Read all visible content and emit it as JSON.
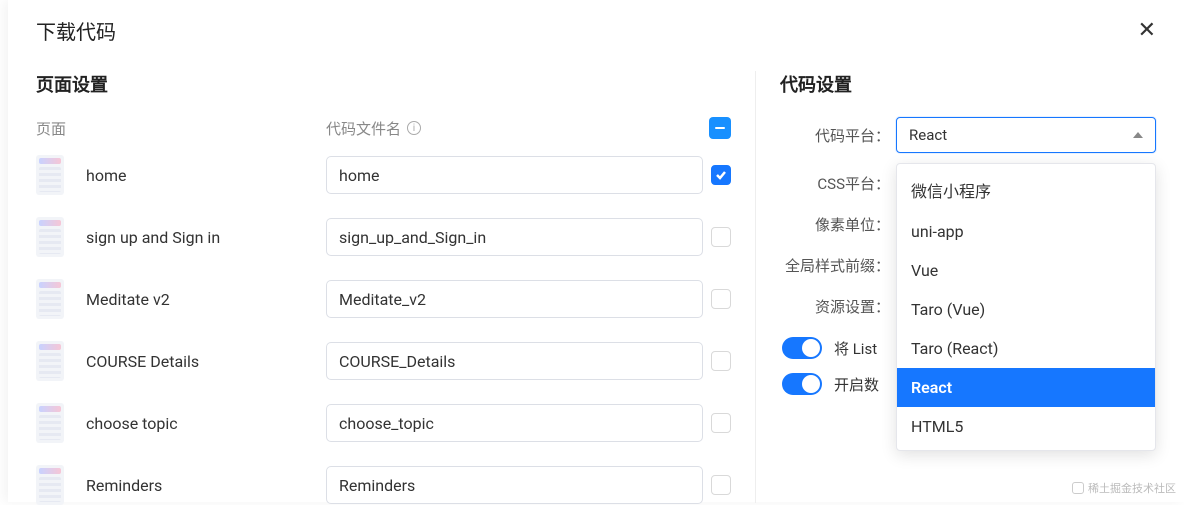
{
  "header": {
    "title": "下载代码"
  },
  "left": {
    "section_title": "页面设置",
    "col_page_label": "页面",
    "col_file_label": "代码文件名",
    "rows": [
      {
        "page": "home",
        "file": "home",
        "checked": true
      },
      {
        "page": "sign up and Sign in",
        "file": "sign_up_and_Sign_in",
        "checked": false
      },
      {
        "page": "Meditate v2",
        "file": "Meditate_v2",
        "checked": false
      },
      {
        "page": "COURSE Details",
        "file": "COURSE_Details",
        "checked": false
      },
      {
        "page": "choose topic",
        "file": "choose_topic",
        "checked": false
      },
      {
        "page": "Reminders",
        "file": "Reminders",
        "checked": false
      }
    ]
  },
  "right": {
    "section_title": "代码设置",
    "labels": {
      "platform": "代码平台：",
      "css": "CSS平台：",
      "unit": "像素单位：",
      "prefix": "全局样式前缀：",
      "resource": "资源设置："
    },
    "platform_value": "React",
    "dropdown_options": [
      "微信小程序",
      "uni-app",
      "Vue",
      "Taro (Vue)",
      "Taro (React)",
      "React",
      "HTML5"
    ],
    "dropdown_selected": "React",
    "toggles": [
      {
        "label_prefix": "将 List",
        "on": true
      },
      {
        "label_prefix": "开启数",
        "on": true
      }
    ]
  },
  "watermark": {
    "text": "稀土掘金技术社区"
  }
}
